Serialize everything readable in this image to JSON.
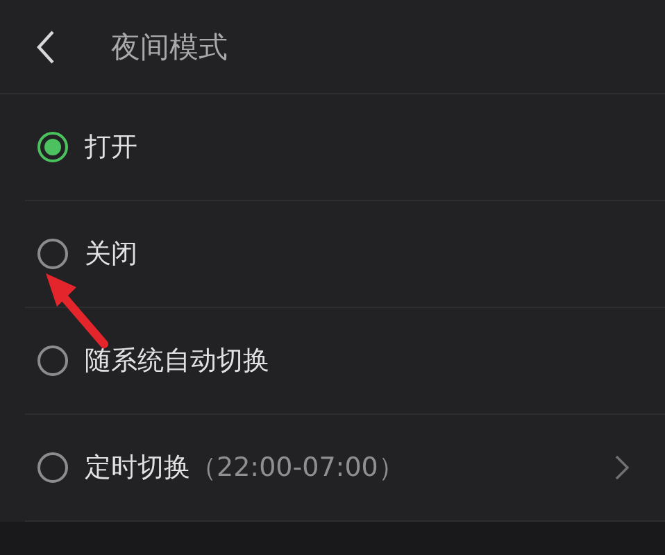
{
  "header": {
    "title": "夜间模式"
  },
  "options": [
    {
      "label": "打开",
      "selected": true
    },
    {
      "label": "关闭",
      "selected": false
    },
    {
      "label": "随系统自动切换",
      "selected": false
    },
    {
      "label": "定时切换",
      "detail": "（22:00-07:00）",
      "selected": false,
      "kind": "link"
    }
  ]
}
